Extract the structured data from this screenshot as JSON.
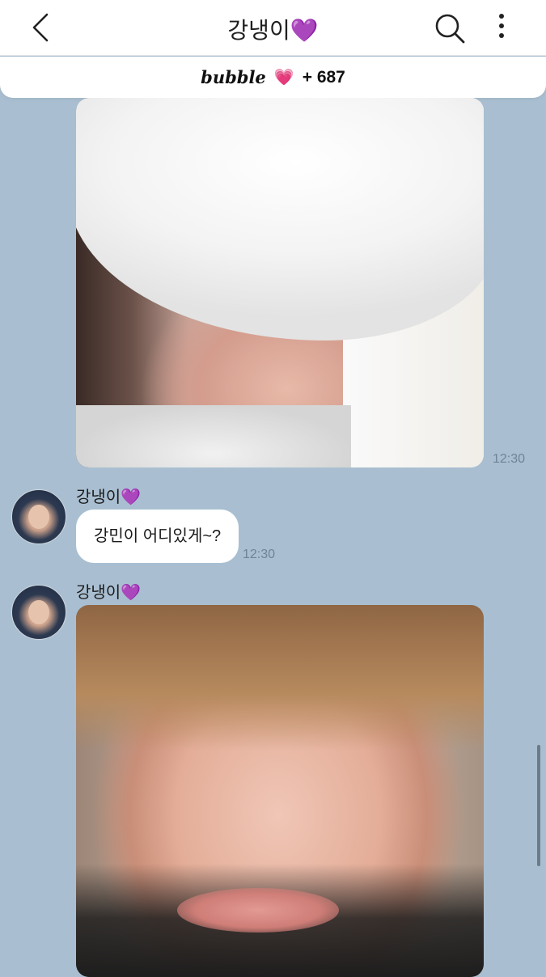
{
  "header": {
    "title": "강냉이💜",
    "back_icon": "chevron-left-icon",
    "search_icon": "search-icon",
    "menu_icon": "more-vertical-icon"
  },
  "bubble_bar": {
    "brand": "bubble",
    "heart": "💗",
    "count": "+ 687"
  },
  "messages": [
    {
      "type": "image",
      "description_icon": "photo",
      "time": "12:30"
    },
    {
      "type": "text",
      "sender": "강냉이💜",
      "text": "강민이 어디있게~?",
      "time": "12:30"
    },
    {
      "type": "image",
      "sender": "강냉이💜"
    }
  ],
  "colors": {
    "chat_background": "#a9bfd1",
    "bubble_background": "#ffffff",
    "time_text": "#6f8496"
  }
}
